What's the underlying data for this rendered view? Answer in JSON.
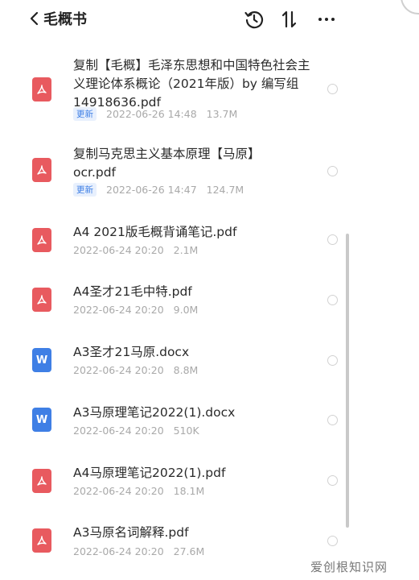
{
  "header": {
    "title": "毛概书",
    "icons": [
      "chevron-left-icon",
      "history-icon",
      "sort-icon",
      "more-icon"
    ]
  },
  "files": [
    {
      "name": "复制【毛概】毛泽东思想和中国特色社会主义理论体系概论（2021年版）by 编写组14918636.pdf",
      "type": "pdf",
      "badge": "更新",
      "date": "2022-06-26 14:48",
      "size": "13.7M"
    },
    {
      "name": "复制马克思主义基本原理【马原】ocr.pdf",
      "type": "pdf",
      "badge": "更新",
      "date": "2022-06-26 14:47",
      "size": "124.7M"
    },
    {
      "name": "A4 2021版毛概背诵笔记.pdf",
      "type": "pdf",
      "badge": "",
      "date": "2022-06-24 20:20",
      "size": "2.1M"
    },
    {
      "name": "A4圣才21毛中特.pdf",
      "type": "pdf",
      "badge": "",
      "date": "2022-06-24 20:20",
      "size": "9.0M"
    },
    {
      "name": "A3圣才21马原.docx",
      "type": "docx",
      "badge": "",
      "date": "2022-06-24 20:20",
      "size": "8.8M"
    },
    {
      "name": "A3马原理笔记2022(1).docx",
      "type": "docx",
      "badge": "",
      "date": "2022-06-24 20:20",
      "size": "510K"
    },
    {
      "name": "A4马原理笔记2022(1).pdf",
      "type": "pdf",
      "badge": "",
      "date": "2022-06-24 20:20",
      "size": "18.1M"
    },
    {
      "name": "A3马原名词解释.pdf",
      "type": "pdf",
      "badge": "",
      "date": "2022-06-24 20:20",
      "size": "27.6M"
    }
  ],
  "watermark": "爱创根知识网",
  "colors": {
    "pdf": "#e85a5f",
    "docx": "#3f7fe5",
    "badge_text": "#3d7ee5",
    "meta": "#a9a9a9"
  }
}
